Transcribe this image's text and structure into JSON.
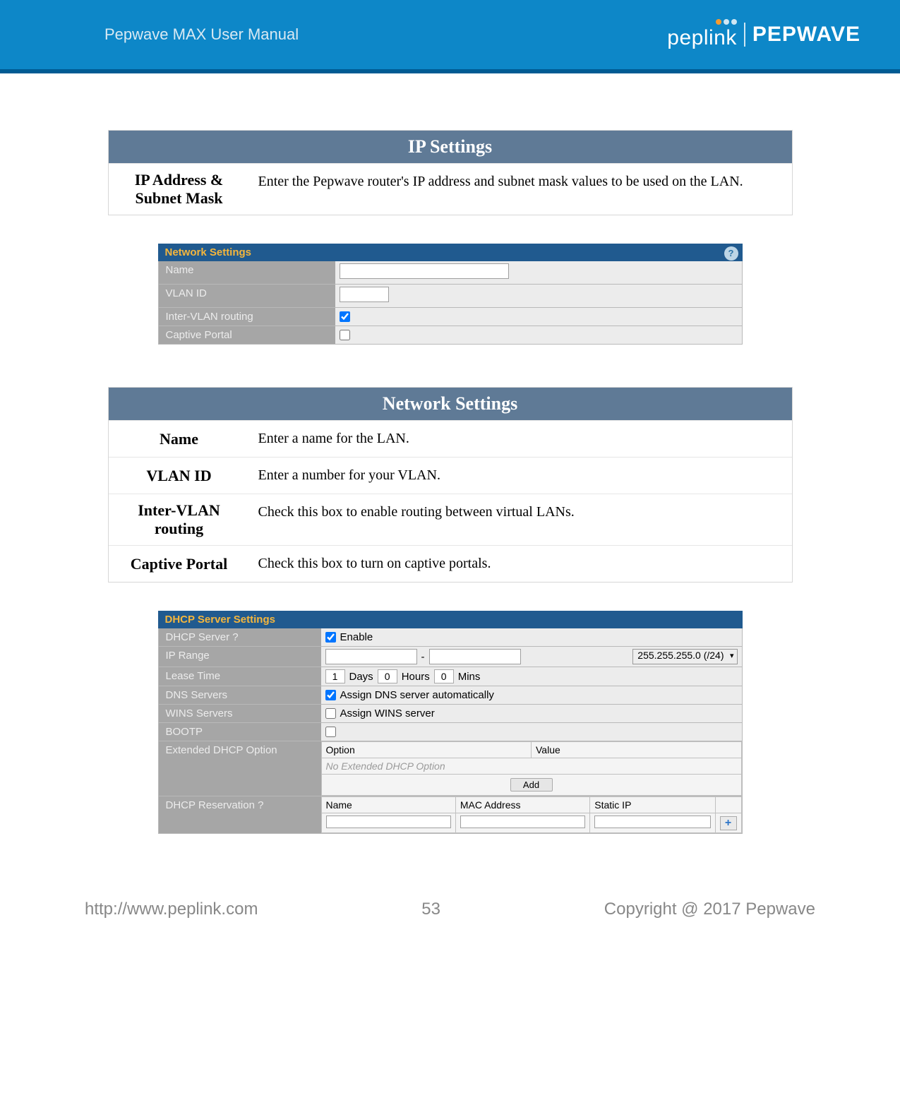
{
  "header": {
    "manual_title": "Pepwave MAX User Manual",
    "brand_left": "peplink",
    "brand_right": "PEPWAVE"
  },
  "ip_settings": {
    "title": "IP Settings",
    "row_label": "IP Address & Subnet Mask",
    "row_desc": "Enter the Pepwave router's IP address and subnet mask values to be used on the LAN."
  },
  "network_settings_ui": {
    "title": "Network Settings",
    "rows": {
      "name": "Name",
      "vlan_id": "VLAN ID",
      "inter_vlan": "Inter-VLAN routing",
      "captive_portal": "Captive Portal"
    },
    "inter_vlan_checked": true,
    "captive_portal_checked": false
  },
  "network_settings_doc": {
    "title": "Network Settings",
    "rows": [
      {
        "label": "Name",
        "desc": "Enter a name for the LAN."
      },
      {
        "label": "VLAN ID",
        "desc": "Enter a number for your VLAN."
      },
      {
        "label": "Inter-VLAN routing",
        "desc": "Check this box to enable routing between virtual LANs."
      },
      {
        "label": "Captive Portal",
        "desc": "Check this box to turn on captive portals."
      }
    ]
  },
  "dhcp_ui": {
    "title": "DHCP Server Settings",
    "dhcp_server_label": "DHCP Server",
    "enable_label": "Enable",
    "enable_checked": true,
    "ip_range_label": "IP Range",
    "ip_range_sep": "-",
    "ip_mask_selected": "255.255.255.0 (/24)",
    "lease_time_label": "Lease Time",
    "lease_days_value": "1",
    "lease_days_label": "Days",
    "lease_hours_value": "0",
    "lease_hours_label": "Hours",
    "lease_mins_value": "0",
    "lease_mins_label": "Mins",
    "dns_servers_label": "DNS Servers",
    "dns_auto_label": "Assign DNS server automatically",
    "dns_auto_checked": true,
    "wins_servers_label": "WINS Servers",
    "wins_assign_label": "Assign WINS server",
    "wins_assign_checked": false,
    "bootp_label": "BOOTP",
    "bootp_checked": false,
    "ext_dhcp_label": "Extended DHCP Option",
    "ext_option_col": "Option",
    "ext_value_col": "Value",
    "ext_empty": "No Extended DHCP Option",
    "add_btn": "Add",
    "dhcp_res_label": "DHCP Reservation",
    "res_name_col": "Name",
    "res_mac_col": "MAC Address",
    "res_ip_col": "Static IP",
    "plus": "+"
  },
  "footer": {
    "url": "http://www.peplink.com",
    "page": "53",
    "copyright": "Copyright @ 2017 Pepwave"
  }
}
